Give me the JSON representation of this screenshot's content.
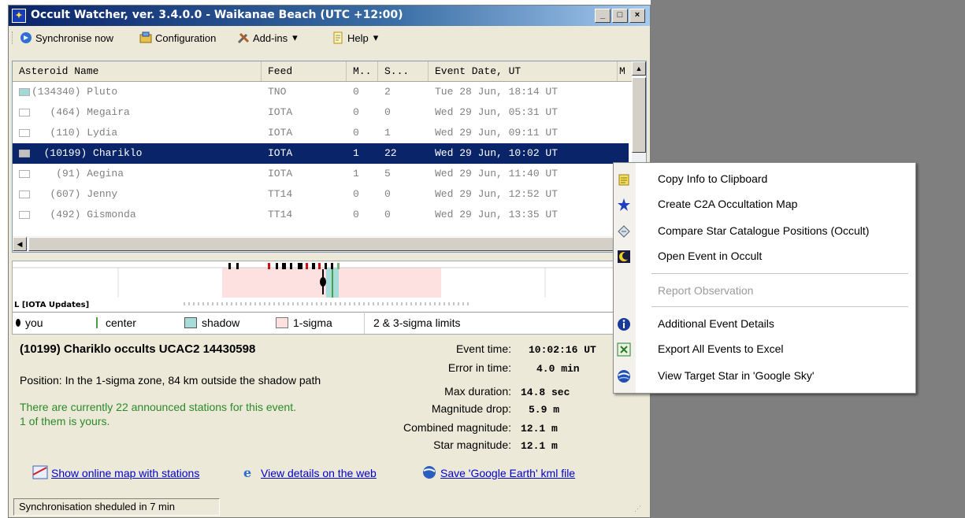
{
  "window": {
    "title": "Occult Watcher, ver. 3.4.0.0 - Waikanae Beach (UTC +12:00)",
    "controls": {
      "minimize": "_",
      "maximize": "□",
      "close": "×"
    }
  },
  "toolbar": {
    "sync_label": "Synchronise now",
    "config_label": "Configuration",
    "addins_label": "Add-ins",
    "help_label": "Help",
    "dropdown_arrow": "▾"
  },
  "list": {
    "columns": [
      "Asteroid Name",
      "Feed",
      "M..",
      "S...",
      "Event Date, UT",
      "M"
    ],
    "rows": [
      {
        "name": "(134340) Pluto",
        "feed": "TNO",
        "m": "0",
        "s": "2",
        "date": "Tue 28 Jun, 18:14 UT",
        "marker": "#a4d8d8",
        "selected": false
      },
      {
        "name": "   (464) Megaira",
        "feed": "IOTA",
        "m": "0",
        "s": "0",
        "date": "Wed 29 Jun, 05:31 UT",
        "marker": "#ffffff",
        "selected": false
      },
      {
        "name": "   (110) Lydia",
        "feed": "IOTA",
        "m": "0",
        "s": "1",
        "date": "Wed 29 Jun, 09:11 UT",
        "marker": "#ffffff",
        "selected": false
      },
      {
        "name": "  (10199) Chariklo",
        "feed": "IOTA",
        "m": "1",
        "s": "22",
        "date": "Wed 29 Jun, 10:02 UT",
        "marker": "#c0c0c0",
        "selected": true
      },
      {
        "name": "    (91) Aegina",
        "feed": "IOTA",
        "m": "1",
        "s": "5",
        "date": "Wed 29 Jun, 11:40 UT",
        "marker": "#ffffff",
        "selected": false
      },
      {
        "name": "   (607) Jenny",
        "feed": "TT14",
        "m": "0",
        "s": "0",
        "date": "Wed 29 Jun, 12:52 UT",
        "marker": "#ffffff",
        "selected": false
      },
      {
        "name": "   (492) Gismonda",
        "feed": "TT14",
        "m": "0",
        "s": "0",
        "date": "Wed 29 Jun, 13:35 UT",
        "marker": "#ffffff",
        "selected": false
      }
    ]
  },
  "visual": {
    "feed_label": "L [IOTA Updates]",
    "legend": {
      "you": "you",
      "center": "center",
      "shadow": "shadow",
      "sigma1": "1-sigma",
      "limits": "2 & 3-sigma limits"
    },
    "colors": {
      "shadow": "#a8dcd8",
      "sigma1": "#fde0e0",
      "center": "#4a9f4a"
    }
  },
  "info": {
    "event_title": "(10199) Chariklo occults UCAC2 14430598",
    "position": "Position:  In the 1-sigma zone, 84 km outside the shadow path",
    "stations_line1": "There are currently 22 announced stations for this event.",
    "stations_line2": "1 of them is yours.",
    "stations_color": "#2a8a2a",
    "details": [
      {
        "label": "Event time:",
        "value": "10:02:16 UT"
      },
      {
        "label": "Error in time:",
        "value": "4.0 min"
      },
      {
        "label": "Max duration:",
        "value": "14.8 sec"
      },
      {
        "label": "Magnitude drop:",
        "value": "5.9 m"
      },
      {
        "label": "Combined magnitude:",
        "value": "12.1 m"
      },
      {
        "label": "Star magnitude:",
        "value": "12.1 m"
      }
    ],
    "links": {
      "map": "Show online map with stations",
      "web": "View details on the web",
      "kml": "Save 'Google Earth' kml file"
    }
  },
  "status": {
    "text": "Synchronisation sheduled in 7 min"
  },
  "context_menu": {
    "items": [
      {
        "label": "Copy Info to Clipboard",
        "enabled": true
      },
      {
        "label": "Create C2A Occultation Map",
        "enabled": true
      },
      {
        "label": "Compare Star Catalogue Positions (Occult)",
        "enabled": true
      },
      {
        "label": "Open Event in Occult",
        "enabled": true
      },
      {
        "label": "Report Observation",
        "enabled": false
      },
      {
        "label": "Additional Event Details",
        "enabled": true
      },
      {
        "label": "Export All Events to Excel",
        "enabled": true
      },
      {
        "label": "View Target Star in 'Google Sky'",
        "enabled": true
      }
    ]
  }
}
